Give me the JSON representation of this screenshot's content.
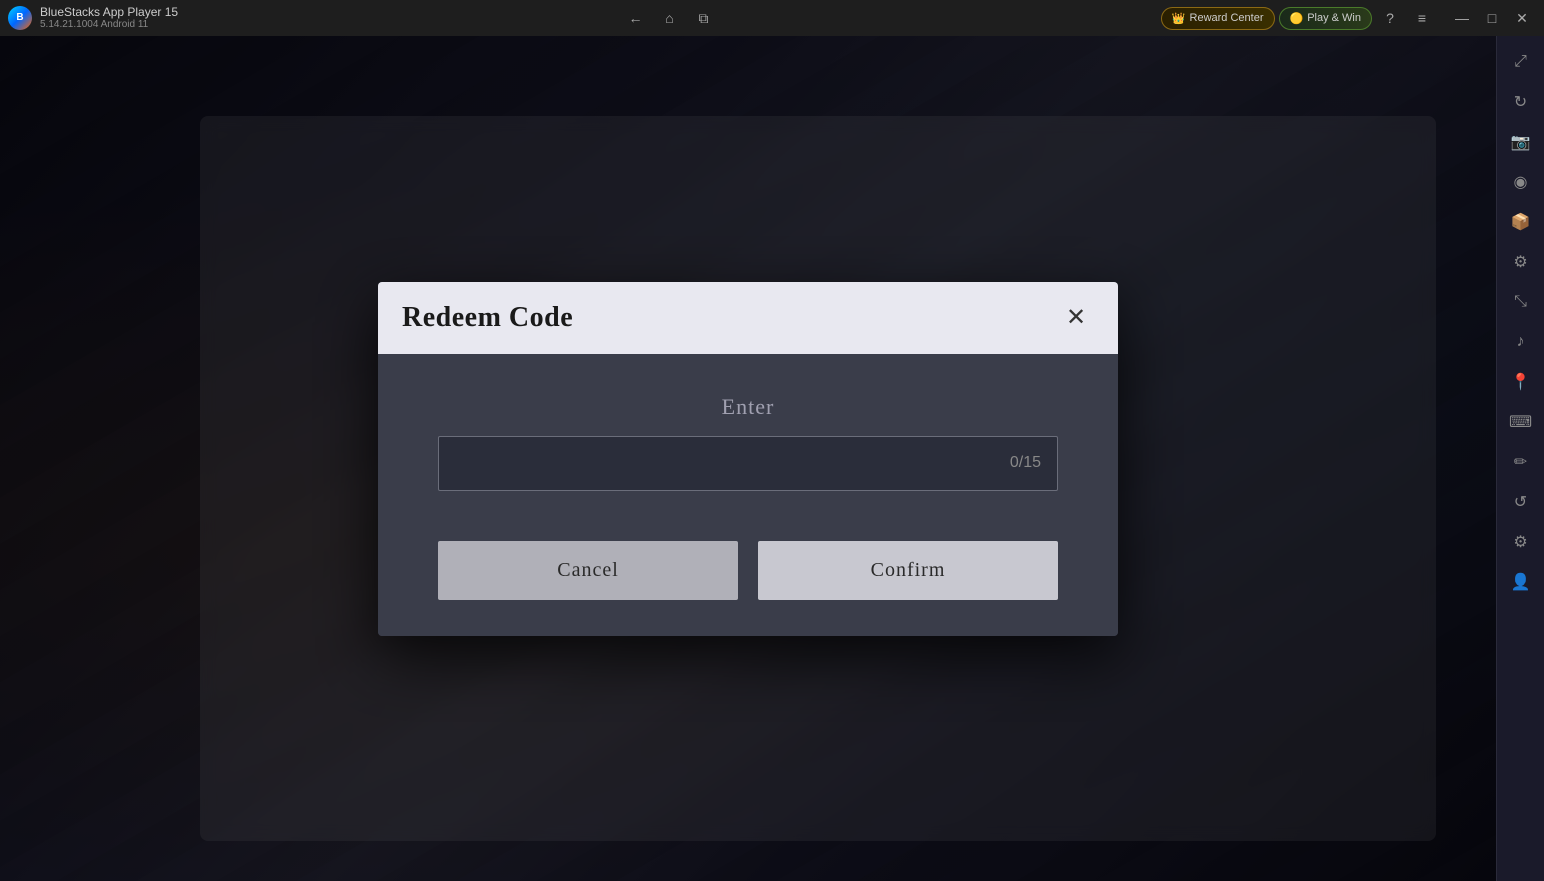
{
  "titlebar": {
    "app_name": "BlueStacks App Player 15",
    "version": "5.14.21.1004  Android 11",
    "nav": {
      "back_label": "←",
      "home_label": "⌂",
      "copy_label": "⧉"
    },
    "reward_center_label": "Reward Center",
    "play_win_label": "Play & Win",
    "help_label": "?",
    "menu_label": "≡",
    "minimize_label": "—",
    "maximize_label": "□",
    "close_label": "✕",
    "sidebar_expand_label": "⤢"
  },
  "sidebar": {
    "icons": [
      {
        "name": "expand-icon",
        "symbol": "⤢"
      },
      {
        "name": "rotate-icon",
        "symbol": "↻"
      },
      {
        "name": "screenshot-icon",
        "symbol": "📷"
      },
      {
        "name": "camera-icon",
        "symbol": "◉"
      },
      {
        "name": "apk-icon",
        "symbol": "📦"
      },
      {
        "name": "settings-icon",
        "symbol": "⚙"
      },
      {
        "name": "zoom-icon",
        "symbol": "⤡"
      },
      {
        "name": "media-icon",
        "symbol": "🎵"
      },
      {
        "name": "location-icon",
        "symbol": "📍"
      },
      {
        "name": "keyboard-icon",
        "symbol": "⌨"
      },
      {
        "name": "brush-icon",
        "symbol": "🖌"
      },
      {
        "name": "refresh-icon",
        "symbol": "🔄"
      },
      {
        "name": "gear2-icon",
        "symbol": "⚙"
      },
      {
        "name": "account-icon",
        "symbol": "👤"
      }
    ]
  },
  "dialog": {
    "title": "Redeem Code",
    "close_label": "✕",
    "enter_label": "Enter",
    "input_placeholder": "",
    "input_counter": "0/15",
    "cancel_label": "Cancel",
    "confirm_label": "Confirm"
  }
}
